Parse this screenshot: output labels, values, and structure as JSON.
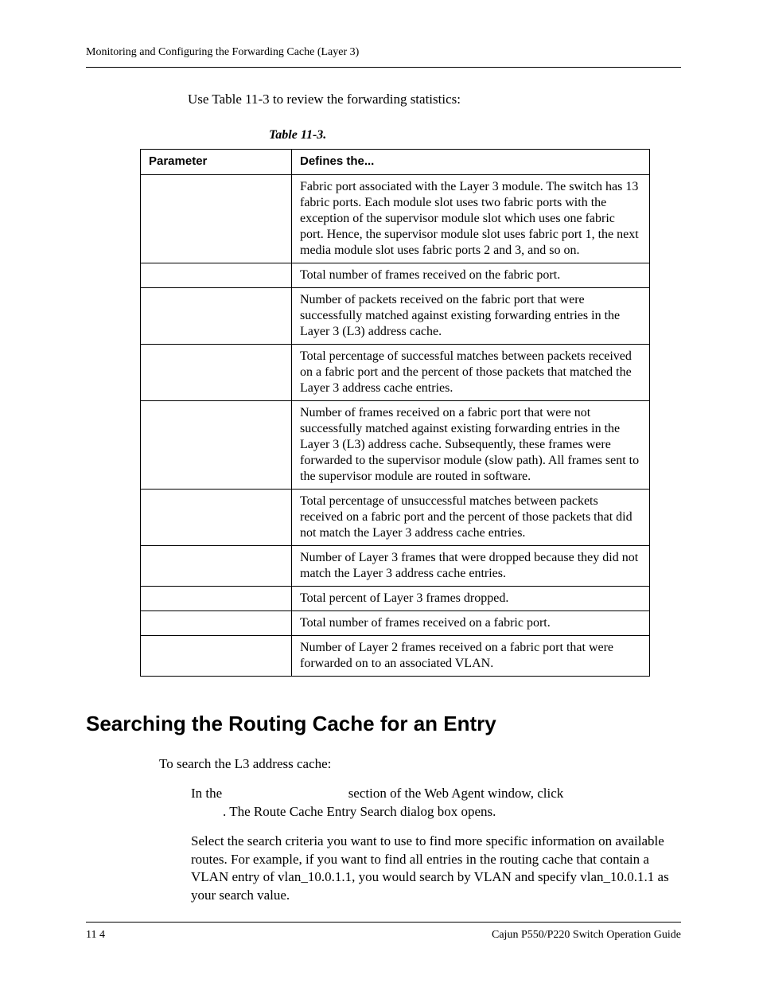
{
  "header": {
    "running_head": "Monitoring and Configuring the Forwarding Cache (Layer 3)"
  },
  "intro": "Use Table 11-3 to review the forwarding statistics:",
  "table": {
    "caption": "Table 11-3.",
    "headers": {
      "col1": "Parameter",
      "col2": "Defines the..."
    },
    "rows": [
      {
        "param": "",
        "def": "Fabric port associated with the Layer 3 module. The switch has 13 fabric ports. Each module slot uses two fabric ports with the exception of the supervisor module slot which uses one fabric port. Hence, the supervisor module slot uses fabric port 1, the next media module slot uses fabric ports 2 and 3, and so on."
      },
      {
        "param": "",
        "def": "Total number of frames received on the fabric port."
      },
      {
        "param": "",
        "def": "Number of packets received on the fabric port that were successfully matched against existing forwarding entries in the Layer 3 (L3) address cache."
      },
      {
        "param": "",
        "def": "Total percentage of successful matches between packets received on a fabric port and the percent of those packets that matched the Layer 3 address cache entries."
      },
      {
        "param": "",
        "def": "Number of frames received on a fabric port that were not successfully matched against existing forwarding entries in the Layer 3 (L3) address cache. Subsequently, these frames were forwarded to the supervisor module (slow path). All frames sent to the supervisor module are routed in software."
      },
      {
        "param": "",
        "def": "Total percentage of unsuccessful matches between packets received on a fabric port and the percent of those packets that did not match the Layer 3 address cache entries."
      },
      {
        "param": "",
        "def": "Number of Layer 3 frames that were dropped because they did not match the Layer 3 address cache entries."
      },
      {
        "param": "",
        "def": "Total percent of Layer 3 frames dropped."
      },
      {
        "param": "",
        "def": "Total number of frames received on a fabric port."
      },
      {
        "param": "",
        "def": "Number of Layer 2 frames received on a fabric port that were forwarded on to an associated VLAN."
      }
    ]
  },
  "section": {
    "heading": "Searching the Routing Cache for an Entry",
    "lead": "To search the L3 address cache:",
    "step1_a": "In the",
    "step1_b": "section of the Web Agent window, click",
    "step1_c": ". The Route Cache Entry Search dialog box opens.",
    "step2": "Select the search criteria you want to use to find more specific information on available routes. For example, if you want to find all entries in the routing cache that contain a VLAN entry of vlan_10.0.1.1, you would search by VLAN and specify vlan_10.0.1.1 as your search value."
  },
  "footer": {
    "left": "11 4",
    "right": "Cajun P550/P220 Switch Operation Guide"
  }
}
